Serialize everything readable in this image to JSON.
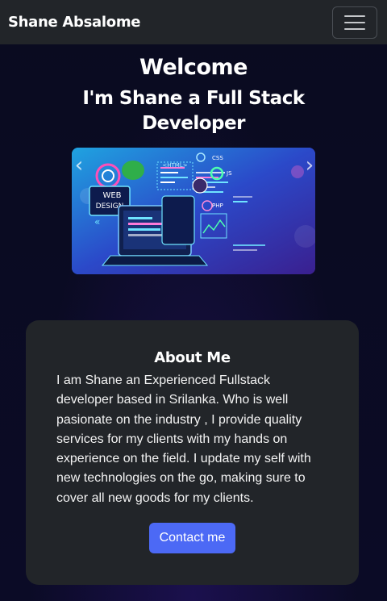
{
  "navbar": {
    "brand": "Shane Absalome",
    "toggle_icon": "hamburger-menu-icon"
  },
  "hero": {
    "welcome": "Welcome",
    "tagline": "I'm Shane a Full Stack Developer"
  },
  "carousel": {
    "prev_icon": "chevron-left-icon",
    "next_icon": "chevron-right-icon",
    "slide_labels": {
      "web": "WEB",
      "design": "DESIGN",
      "html": "<HTML>",
      "css": "CSS",
      "php": "PHP",
      "js": "JS"
    }
  },
  "about": {
    "title": "About Me",
    "body": "I am Shane an Experienced Fullstack developer based in Srilanka. Who is well pasionate on the industry , I provide quality services for my clients with my hands on experience on the field. I update my self with new technologies on the go, making sure to cover all new goods for my clients.",
    "button_label": "Contact me"
  },
  "colors": {
    "navbar_bg": "#222529",
    "page_bg": "#090a1f",
    "card_bg": "#222529",
    "button_bg": "#4c69f5"
  }
}
